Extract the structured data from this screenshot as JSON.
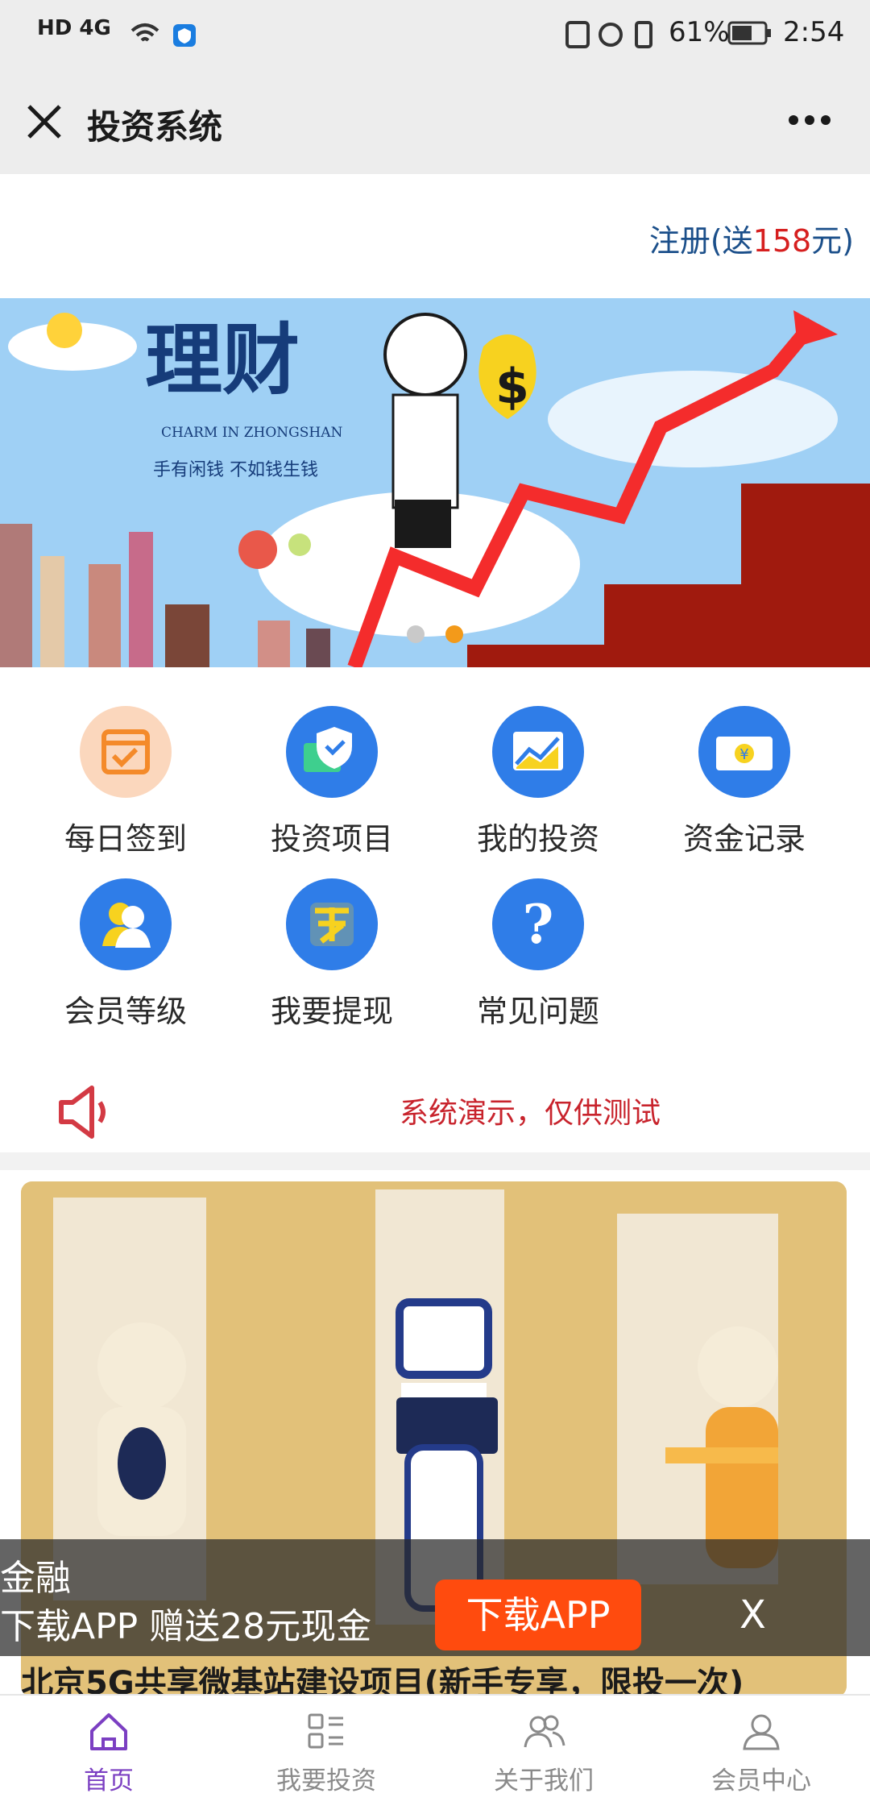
{
  "status_bar": {
    "left_text": "HD 4G",
    "battery": "61%",
    "time": "2:54"
  },
  "nav": {
    "title": "投资系统"
  },
  "register": {
    "prefix": "注册(送",
    "amount": "158",
    "suffix": "元)"
  },
  "banner": {
    "big_title": "理财",
    "subtitle": "CHARM IN ZHONGSHAN",
    "tagline": "手有闲钱  不如钱生钱",
    "dots": 2,
    "active_dot": 1
  },
  "menu": {
    "items": [
      {
        "label": "每日签到",
        "icon": "calendar-check-icon",
        "color": "#fbd7bd"
      },
      {
        "label": "投资项目",
        "icon": "shield-wallet-icon",
        "color": "#2f7de8"
      },
      {
        "label": "我的投资",
        "icon": "chart-icon",
        "color": "#2f7de8"
      },
      {
        "label": "资金记录",
        "icon": "money-icon",
        "color": "#2f7de8"
      },
      {
        "label": "会员等级",
        "icon": "member-icon",
        "color": "#2f7de8"
      },
      {
        "label": "我要提现",
        "icon": "withdraw-icon",
        "color": "#2f7de8"
      },
      {
        "label": "常见问题",
        "icon": "question-icon",
        "color": "#2f7de8"
      }
    ]
  },
  "notice": {
    "text": "系统演示，仅供测试"
  },
  "product": {
    "title": "北京5G共享微基站建设项目(新手专享，限投一次)"
  },
  "download_bar": {
    "title": "金融",
    "subtitle": "下载APP 赠送28元现金",
    "button": "下载APP",
    "close": "X"
  },
  "tabs": [
    {
      "label": "首页",
      "icon": "home-icon",
      "active": true
    },
    {
      "label": "我要投资",
      "icon": "list-icon",
      "active": false
    },
    {
      "label": "关于我们",
      "icon": "users-icon",
      "active": false
    },
    {
      "label": "会员中心",
      "icon": "user-icon",
      "active": false
    }
  ],
  "colors": {
    "accent": "#7b3fc2",
    "notice_red": "#c8232c",
    "register_blue": "#1b4f8a",
    "download_orange": "#ff4b0e"
  }
}
